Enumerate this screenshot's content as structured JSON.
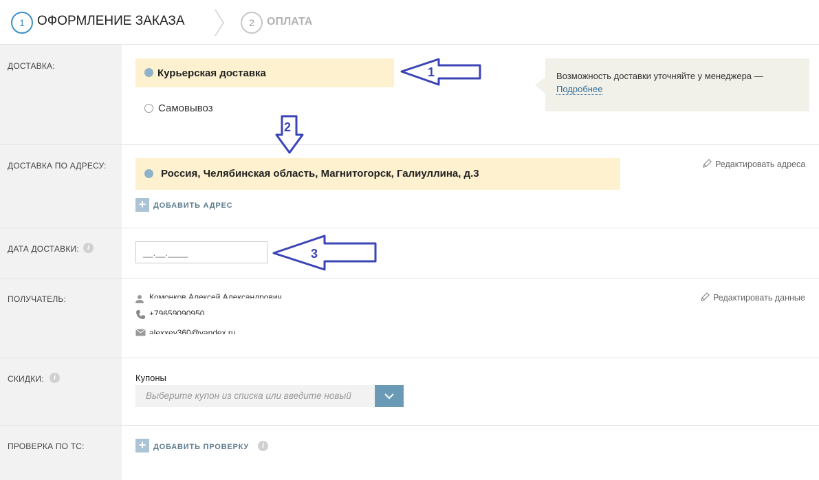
{
  "steps": [
    {
      "num": "1",
      "label": "ОФОРМЛЕНИЕ ЗАКАЗА"
    },
    {
      "num": "2",
      "label": "ОПЛАТА"
    }
  ],
  "delivery": {
    "label": "ДОСТАВКА:",
    "options": [
      "Курьерская доставка",
      "Самовывоз"
    ],
    "selected": "Курьерская доставка",
    "tip_text": "Возможность доставки уточняйте у менеджера —",
    "tip_link": "Подробнее"
  },
  "address": {
    "label": "ДОСТАВКА ПО АДРЕСУ:",
    "selected_address": "Россия, Челябинская область, Магнитогорск, Галиуллина, д.3",
    "add_label": "ДОБАВИТЬ АДРЕС",
    "edit_label": "Редактировать адреса"
  },
  "date": {
    "label": "ДАТА ДОСТАВКИ:",
    "placeholder": "__.__.____"
  },
  "recipient": {
    "label": "ПОЛУЧАТЕЛЬ:",
    "name": "Комонков Алексей Александрович",
    "phone": "+79659090950",
    "email": "alexxey360@yandex.ru",
    "edit_label": "Редактировать данные"
  },
  "discounts": {
    "label": "СКИДКИ:",
    "coupons_title": "Купоны",
    "coupon_placeholder": "Выберите купон из списка или введите новый"
  },
  "check": {
    "label": "ПРОВЕРКА ПО ТС:",
    "add_label": "ДОБАВИТЬ ПРОВЕРКУ"
  },
  "annotations": [
    "1",
    "2",
    "3"
  ],
  "colors": {
    "accent": "#3d8fc6",
    "selected_bg": "#fdf1cf",
    "annotation": "#3a44b5",
    "button": "#6b9ab6"
  }
}
